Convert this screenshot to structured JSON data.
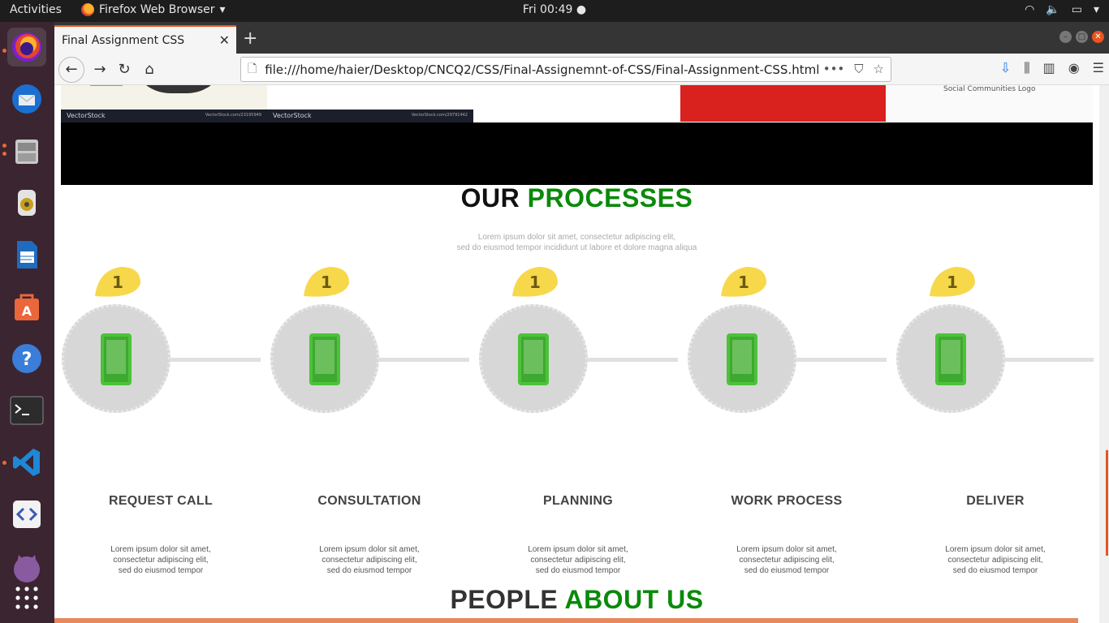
{
  "topbar": {
    "activities": "Activities",
    "app_name": "Firefox Web Browser",
    "clock": "Fri 00:49 ●"
  },
  "browser": {
    "tab_title": "Final Assignment CSS",
    "url": "file:///home/haier/Desktop/CNCQ2/CSS/Final-Assignemnt-of-CSS/Final-Assignment-CSS.html",
    "url_actions": [
      "•••",
      "⛉",
      "☆"
    ]
  },
  "gallery": {
    "vectorstock_1": "VectorStock",
    "vectorstock_1_id": "VectorStock.com/23195949",
    "vectorstock_2": "VectorStock",
    "vectorstock_2_id": "VectorStock.com/29791442",
    "social_caption": "Social Communities Logo"
  },
  "processes": {
    "title_part1": "OUR",
    "title_part2": "PROCESSES",
    "subtitle_line1": "Lorem ipsum dolor sit amet, consectetur adipiscing elit,",
    "subtitle_line2": "sed do eiusmod tempor incididunt ut labore et dolore magna aliqua",
    "coin_number": "1",
    "steps": [
      {
        "label": "REQUEST CALL",
        "desc1": "Lorem ipsum dolor sit amet,",
        "desc2": "consectetur adipiscing elit,",
        "desc3": "sed do eiusmod tempor"
      },
      {
        "label": "CONSULTATION",
        "desc1": "Lorem ipsum dolor sit amet,",
        "desc2": "consectetur adipiscing elit,",
        "desc3": "sed do eiusmod tempor"
      },
      {
        "label": "PLANNING",
        "desc1": "Lorem ipsum dolor sit amet,",
        "desc2": "consectetur adipiscing elit,",
        "desc3": "sed do eiusmod tempor"
      },
      {
        "label": "WORK PROCESS",
        "desc1": "Lorem ipsum dolor sit amet,",
        "desc2": "consectetur adipiscing elit,",
        "desc3": "sed do eiusmod tempor"
      },
      {
        "label": "DELIVER",
        "desc1": "Lorem ipsum dolor sit amet,",
        "desc2": "consectetur adipiscing elit,",
        "desc3": "sed do eiusmod tempor"
      }
    ]
  },
  "about": {
    "title_part1": "PEOPLE",
    "title_part2": "ABOUT US"
  },
  "colors": {
    "accent_green": "#0a8a0a",
    "ubuntu_orange": "#e95420",
    "coin_yellow": "#f7d84a"
  }
}
